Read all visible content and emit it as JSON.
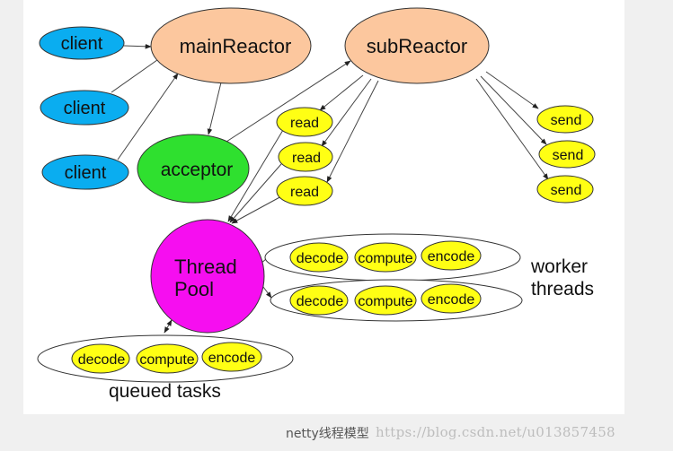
{
  "diagram": {
    "nodes": {
      "client_1": "client",
      "client_2": "client",
      "client_3": "client",
      "main_reactor": "mainReactor",
      "sub_reactor": "subReactor",
      "acceptor": "acceptor",
      "read_1": "read",
      "read_2": "read",
      "read_3": "read",
      "send_1": "send",
      "send_2": "send",
      "send_3": "send",
      "thread_pool_line1": "Thread",
      "thread_pool_line2": "Pool"
    },
    "worker_row_1": [
      "decode",
      "compute",
      "encode"
    ],
    "worker_row_2": [
      "decode",
      "compute",
      "encode"
    ],
    "queued_row": [
      "decode",
      "compute",
      "encode"
    ],
    "worker_threads_line1": "worker",
    "worker_threads_line2": "threads",
    "queued_tasks": "queued tasks",
    "colors": {
      "client": "#0aadf0",
      "reactor": "#fcc79e",
      "acceptor": "#2fe02f",
      "task": "#ffff14",
      "thread_pool": "#f60ef0",
      "container": "#ffffff",
      "stroke": "#333333"
    }
  },
  "footer": {
    "caption": "netty线程模型",
    "watermark": "https://blog.csdn.net/u013857458"
  }
}
